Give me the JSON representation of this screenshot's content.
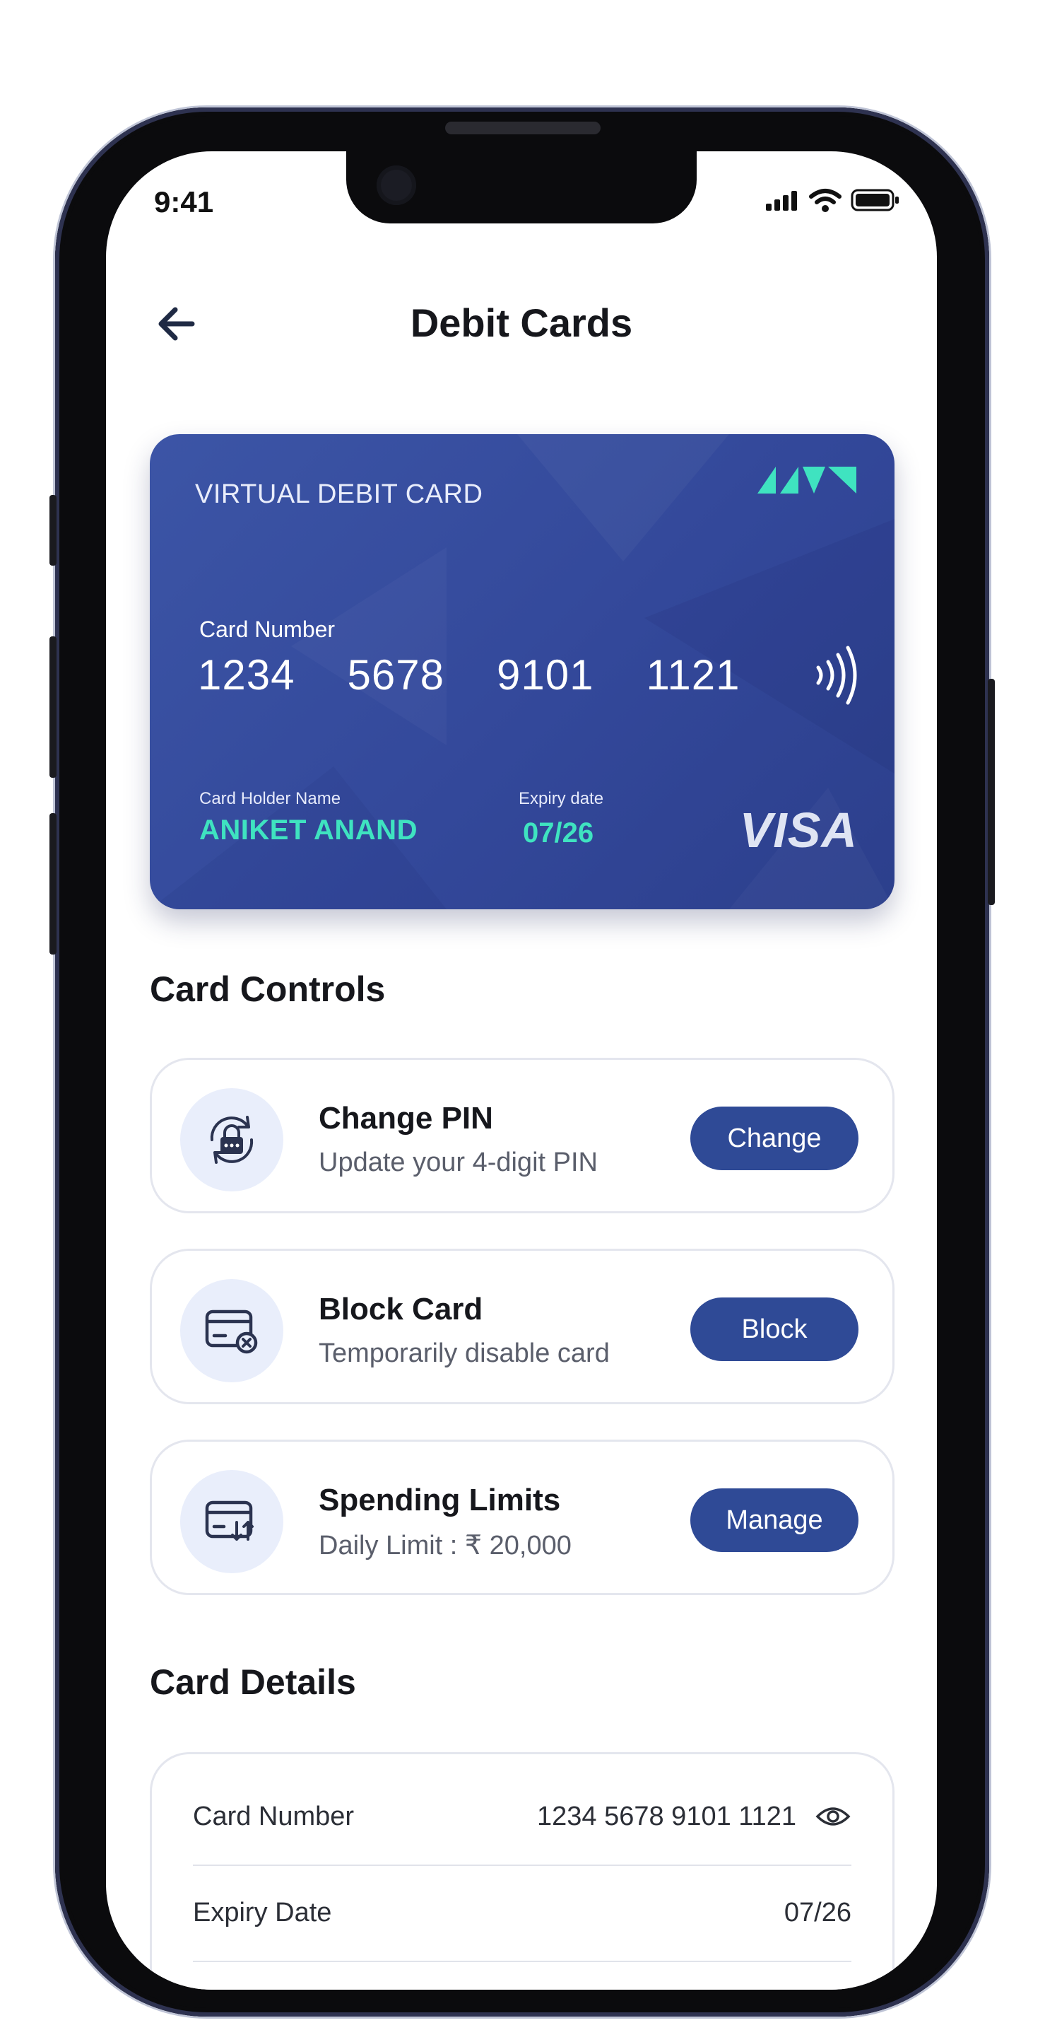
{
  "status_bar": {
    "time": "9:41"
  },
  "header": {
    "title": "Debit Cards"
  },
  "card": {
    "type_label": "VIRTUAL DEBIT CARD",
    "number_label": "Card Number",
    "number_groups": [
      "1234",
      "5678",
      "9101",
      "1121"
    ],
    "holder_label": "Card Holder Name",
    "holder_name": "ANIKET ANAND",
    "expiry_label": "Expiry date",
    "expiry": "07/26",
    "network": "VISA"
  },
  "card_controls": {
    "title": "Card Controls",
    "items": [
      {
        "title": "Change PIN",
        "subtitle": "Update your 4-digit PIN",
        "button": "Change"
      },
      {
        "title": "Block Card",
        "subtitle": "Temporarily disable card",
        "button": "Block"
      },
      {
        "title": "Spending Limits",
        "subtitle": "Daily Limit : ₹ 20,000",
        "button": "Manage"
      }
    ]
  },
  "card_details": {
    "title": "Card Details",
    "rows": [
      {
        "label": "Card Number",
        "value": "1234 5678 9101 1121"
      },
      {
        "label": "Expiry Date",
        "value": "07/26"
      }
    ]
  },
  "colors": {
    "primary": "#2f4a96",
    "card_bg": "#33489a",
    "accent_teal": "#3fe3c0",
    "icon_bg": "#e9eefb"
  },
  "icons": {
    "back": "arrow-left-icon",
    "change_pin": "lock-refresh-icon",
    "block_card": "card-block-icon",
    "spending_limits": "card-transfer-icon",
    "reveal": "eye-icon"
  }
}
